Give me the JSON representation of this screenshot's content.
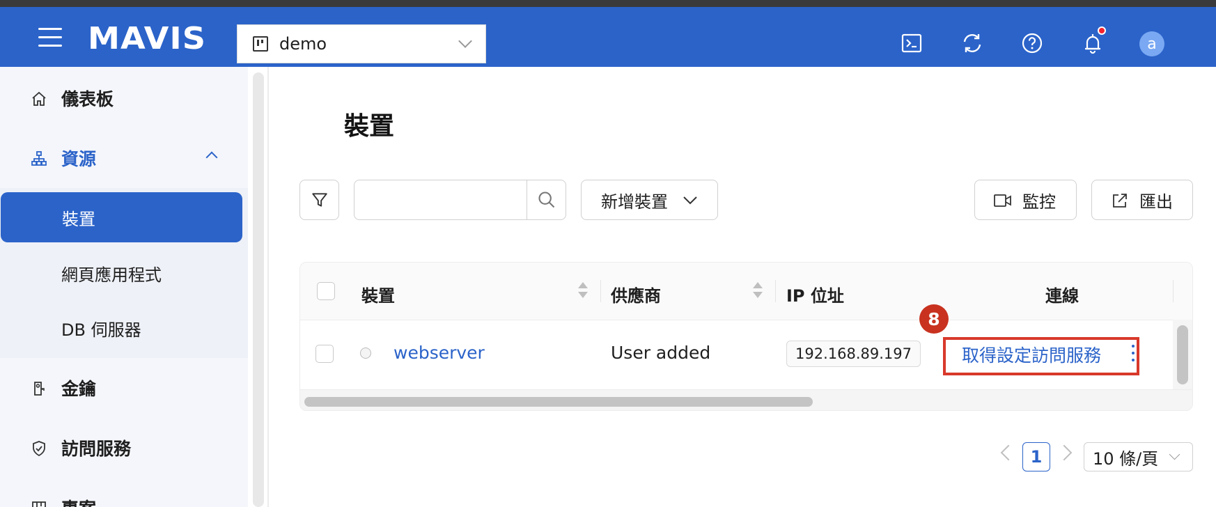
{
  "app": {
    "logo_text": "MAVIS",
    "brand_color": "#2b63c9",
    "project": "demo"
  },
  "header": {
    "icons": [
      "terminal-icon",
      "refresh-icon",
      "help-icon",
      "bell-icon"
    ],
    "avatar_letter": "a"
  },
  "sidebar": {
    "items": [
      {
        "label": "儀表板",
        "icon": "home-icon"
      },
      {
        "label": "資源",
        "icon": "sitemap-icon",
        "expanded": true
      },
      {
        "label": "金鑰",
        "icon": "key-icon"
      },
      {
        "label": "訪問服務",
        "icon": "shield-check-icon"
      },
      {
        "label": "專案",
        "icon": "project-icon"
      }
    ],
    "subitems": [
      {
        "label": "裝置",
        "active": true
      },
      {
        "label": "網頁應用程式"
      },
      {
        "label": "DB 伺服器"
      }
    ]
  },
  "main": {
    "title": "裝置",
    "search_placeholder": "",
    "add_button": "新增裝置",
    "monitor_button": "監控",
    "export_button": "匯出"
  },
  "table": {
    "columns": [
      "裝置",
      "供應商",
      "IP 位址",
      "連線"
    ],
    "rows": [
      {
        "device": "webserver",
        "vendor": "User added",
        "ip": "192.168.89.197",
        "connection": "取得設定訪問服務"
      }
    ]
  },
  "annotation": {
    "step": "8",
    "color": "#d8392b"
  },
  "pagination": {
    "current_page": "1",
    "page_size": "10 條/頁"
  }
}
